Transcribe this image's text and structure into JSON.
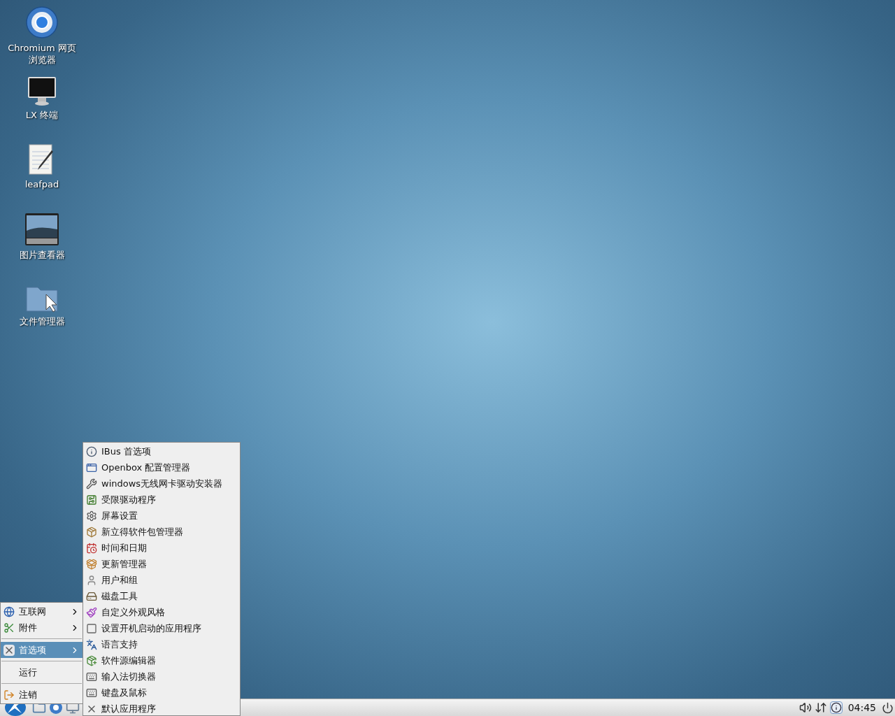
{
  "desktop_icons": [
    {
      "label": "Chromium 网页浏览器"
    },
    {
      "label": "LX 终端"
    },
    {
      "label": "leafpad"
    },
    {
      "label": "图片查看器"
    },
    {
      "label": "文件管理器"
    }
  ],
  "start_menu": {
    "items": [
      {
        "kind": "submenu",
        "label": "互联网",
        "selected": false
      },
      {
        "kind": "submenu",
        "label": "附件",
        "selected": false
      },
      {
        "kind": "separator"
      },
      {
        "kind": "submenu",
        "label": "首选项",
        "selected": true
      },
      {
        "kind": "separator"
      },
      {
        "kind": "item",
        "label": "运行",
        "selected": false
      },
      {
        "kind": "separator"
      },
      {
        "kind": "item",
        "label": "注销",
        "selected": false
      }
    ]
  },
  "submenu": {
    "items": [
      {
        "label": "IBus 首选项"
      },
      {
        "label": "Openbox 配置管理器"
      },
      {
        "label": "windows无线网卡驱动安装器"
      },
      {
        "label": "受限驱动程序"
      },
      {
        "label": "屏幕设置"
      },
      {
        "label": "新立得软件包管理器"
      },
      {
        "label": "时间和日期"
      },
      {
        "label": "更新管理器"
      },
      {
        "label": "用户和组"
      },
      {
        "label": "磁盘工具"
      },
      {
        "label": "自定义外观风格"
      },
      {
        "label": "设置开机启动的应用程序"
      },
      {
        "label": "语言支持"
      },
      {
        "label": "软件源编辑器"
      },
      {
        "label": "输入法切换器"
      },
      {
        "label": "键盘及鼠标"
      },
      {
        "label": "默认应用程序"
      }
    ]
  },
  "taskbar": {
    "clock": "04:45"
  }
}
